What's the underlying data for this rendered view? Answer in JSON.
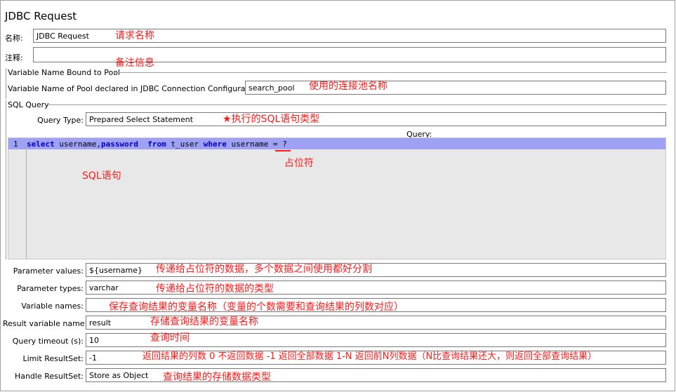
{
  "header": {
    "title": "JDBC Request"
  },
  "name_row": {
    "label": "名称:",
    "value": "JDBC Request",
    "note": "请求名称"
  },
  "comment_row": {
    "label": "注释:",
    "value": "",
    "note": "备注信息"
  },
  "pool_group": {
    "title": "Variable Name Bound to Pool",
    "label": "Variable Name of Pool declared in JDBC Connection Configuration:",
    "value": "search_pool",
    "note": "使用的连接池名称"
  },
  "sql_group": {
    "title": "SQL Query",
    "query_type_label": "Query Type:",
    "query_type_value": "Prepared Select Statement",
    "query_type_note": "执行的SQL语句类型",
    "query_label": "Query:",
    "editor": {
      "line_number": "1",
      "code": {
        "k1": "select",
        "t1": " username,",
        "k2": "password",
        "t2": "  ",
        "k3": "from",
        "t3": " t_user ",
        "k4": "where",
        "t4": " username = ?"
      },
      "placeholder_note": "占位符",
      "sql_note": "SQL语句"
    }
  },
  "params": [
    {
      "label": "Parameter values:",
      "value": "${username}",
      "note": "传递给占位符的数据，多个数据之间使用都好分割"
    },
    {
      "label": "Parameter types:",
      "value": "varchar",
      "note": "传递给占位符的数据的类型"
    },
    {
      "label": "Variable names:",
      "value": "",
      "note": "保存查询结果的变量名称（变量的个数需要和查询结果的列数对应）"
    },
    {
      "label": "Result variable name:",
      "value": "result",
      "note": "存储查询结果的变量名称"
    },
    {
      "label": "Query timeout (s):",
      "value": "10",
      "note": "查询时间"
    },
    {
      "label": "Limit ResultSet:",
      "value": "-1",
      "note": "返回结果的列数  0 不返回数据 -1 返回全部数据  1-N 返回前N列数据（N比查询结果还大，则返回全部查询结果）"
    },
    {
      "label": "Handle ResultSet:",
      "value": "Store as Object",
      "note": "查询结果的存储数据类型"
    }
  ],
  "colors": {
    "annotation": "#ff1a1a",
    "keyword": "#0000c8",
    "highlight": "#9fa1f7",
    "editor_bg": "#e8e8e8"
  }
}
